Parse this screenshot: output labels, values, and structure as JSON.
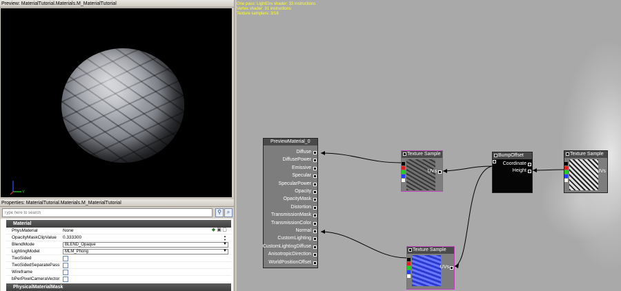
{
  "preview": {
    "title": "Preview: MaterialTutorial.Materials.M_MaterialTutorial",
    "axis_label": "Y"
  },
  "properties": {
    "title": "Properties: MaterialTutorial.Materials.M_MaterialTutorial",
    "search_placeholder": "Type here to search",
    "category_material": "Material",
    "category_physical": "PhysicalMaterialMask",
    "rows": [
      {
        "name": "PhysMaterial",
        "value": "None"
      },
      {
        "name": "OpacityMaskClipValue",
        "value": "0.333300"
      },
      {
        "name": "BlendMode",
        "value": "BLEND_Opaque"
      },
      {
        "name": "LightingModel",
        "value": "MLM_Phong"
      },
      {
        "name": "TwoSided",
        "value": ""
      },
      {
        "name": "TwoSidedSeparatePass",
        "value": ""
      },
      {
        "name": "Wireframe",
        "value": ""
      },
      {
        "name": "bPerPixelCameraVector",
        "value": ""
      }
    ]
  },
  "graph": {
    "stats": [
      "One pass: LightEnv shader: 33 instructions",
      "Vertex shader: 31 instructions",
      "Texture samplers: 3/16"
    ],
    "preview_node": {
      "title": "PreviewMaterial_0",
      "inputs": [
        "Diffuse",
        "DiffusePower",
        "Emissive",
        "Specular",
        "SpecularPower",
        "Opacity",
        "OpacityMask",
        "Distortion",
        "TransmissionMask",
        "TransmissionColor",
        "Normal",
        "CustomLighting",
        "CustomLightingDiffuse",
        "AnisotropicDirection",
        "WorldPositionOffset"
      ]
    },
    "tex1": {
      "title": "Texture Sample",
      "pin": "UVs"
    },
    "bump": {
      "title": "BumpOffset",
      "pins": [
        "Coordinate",
        "Height"
      ]
    },
    "tex2": {
      "title": "Texture Sample",
      "pin": "UVs"
    },
    "tex3": {
      "title": "Texture Sample",
      "pin": "UVs"
    },
    "colors": {
      "bg": "#a9a9a9",
      "stats": "#ffff33",
      "tex_border": "#c040c0",
      "normal_map": "#3a4bd8"
    }
  }
}
